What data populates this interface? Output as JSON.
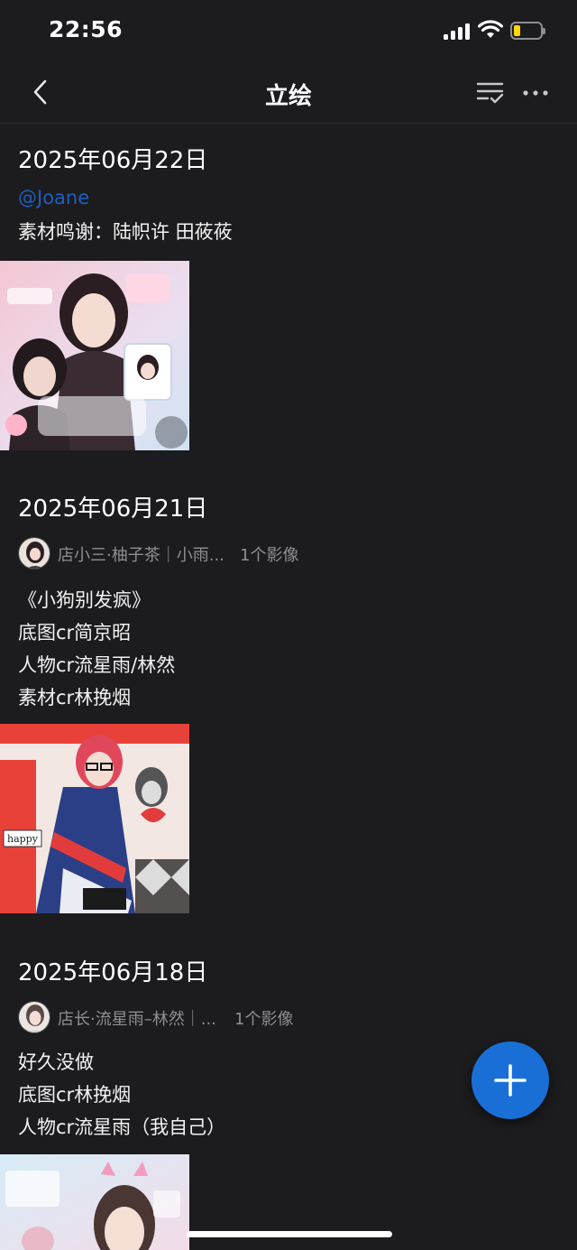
{
  "status_bar": {
    "time": "22:56",
    "battery_color": "#ffd60a"
  },
  "nav": {
    "title": "立绘",
    "back_icon": "chevron-left-icon",
    "sort_icon": "list-check-icon",
    "more_icon": "more-horizontal-icon"
  },
  "entries": [
    {
      "date": "2025年06月22日",
      "mention": "@Joane",
      "lines": [
        "素材鸣谢：陆帜许 田莜莜"
      ]
    },
    {
      "date": "2025年06月21日",
      "author": "店小三·柚子茶｜小雨...",
      "count": "1个影像",
      "lines": [
        "《小狗别发疯》",
        "底图cr简京昭",
        "人物cr流星雨/林然",
        "素材cr林挽烟"
      ],
      "art_text": [
        "happy"
      ]
    },
    {
      "date": "2025年06月18日",
      "author": "店长·流星雨–林然｜...",
      "count": "1个影像",
      "lines": [
        "好久没做",
        "底图cr林挽烟",
        "人物cr流星雨（我自己）"
      ]
    }
  ],
  "fab": {
    "icon": "plus-icon",
    "color": "#1a6fd6"
  },
  "colors": {
    "background": "#1c1c1e",
    "link": "#1f5fbf",
    "muted": "#8e8e93"
  }
}
